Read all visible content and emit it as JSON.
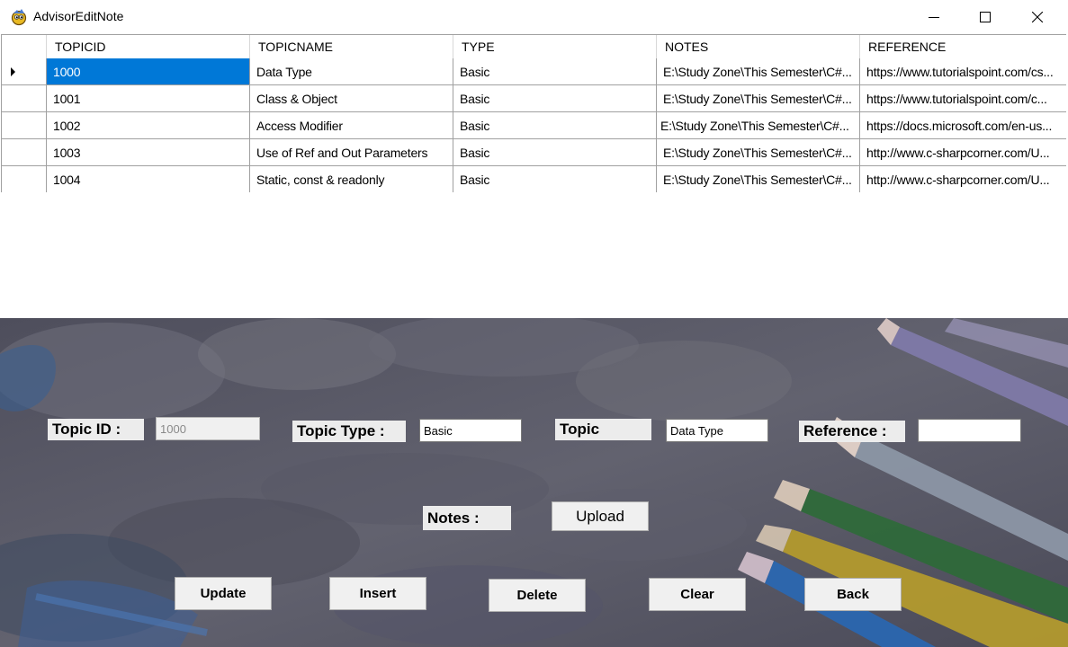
{
  "window": {
    "title": "AdvisorEditNote",
    "icon": "app-icon",
    "controls": [
      "minimize-icon",
      "maximize-icon",
      "close-icon"
    ]
  },
  "grid": {
    "columns": [
      "TOPICID",
      "TOPICNAME",
      "TYPE",
      "NOTES",
      "REFERENCE"
    ],
    "rows": [
      [
        "1000",
        "Data Type",
        "Basic",
        "E:\\Study Zone\\This Semester\\C#...",
        "https://www.tutorialspoint.com/cs..."
      ],
      [
        "1001",
        "Class & Object",
        "Basic",
        "E:\\Study Zone\\This Semester\\C#...",
        "https://www.tutorialspoint.com/c..."
      ],
      [
        "1002",
        "Access Modifier",
        "Basic",
        "E:\\Study Zone\\This Semester\\C#...",
        "https://docs.microsoft.com/en-us..."
      ],
      [
        "1003",
        "Use of Ref and Out Parameters",
        "Basic",
        "E:\\Study Zone\\This Semester\\C#...",
        "http://www.c-sharpcorner.com/U..."
      ],
      [
        "1004",
        "Static, const & readonly",
        "Basic",
        "E:\\Study Zone\\This Semester\\C#...",
        "http://www.c-sharpcorner.com/U..."
      ]
    ],
    "current_row_indicator": "row-pointer-icon",
    "selection_color": "#0078d7"
  },
  "form": {
    "topic_id_label": "Topic ID :",
    "topic_id_value": "1000",
    "topic_type_label": "Topic Type :",
    "topic_type_value": "Basic",
    "topic_label": "Topic",
    "topic_value": "Data Type",
    "reference_label": "Reference :",
    "reference_value": "",
    "notes_label": "Notes :",
    "upload_label": "Upload"
  },
  "buttons": {
    "update": "Update",
    "insert": "Insert",
    "delete": "Delete",
    "clear": "Clear",
    "back": "Back"
  }
}
